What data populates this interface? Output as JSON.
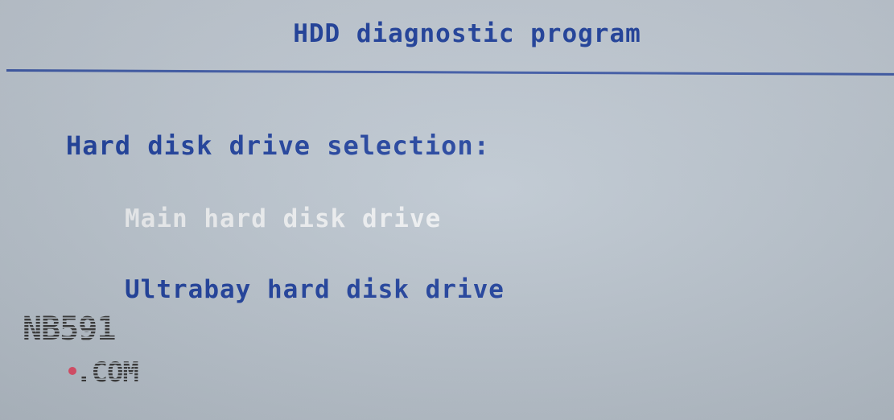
{
  "screen": {
    "title": "HDD diagnostic program",
    "heading": "Hard disk drive selection:",
    "menu": [
      {
        "label": "Main hard disk drive",
        "selected": true
      },
      {
        "label": "Ultrabay hard disk drive",
        "selected": false
      }
    ]
  },
  "watermark": {
    "line1": "NB591",
    "line2": ".COM"
  },
  "colors": {
    "background": "#bcc6d0",
    "text_blue": "#1c3e9c",
    "highlight_white": "#eef0f2",
    "rule_blue": "#3e5aa8",
    "watermark_dark": "#3a3a3a",
    "watermark_dot": "#e0506a"
  }
}
